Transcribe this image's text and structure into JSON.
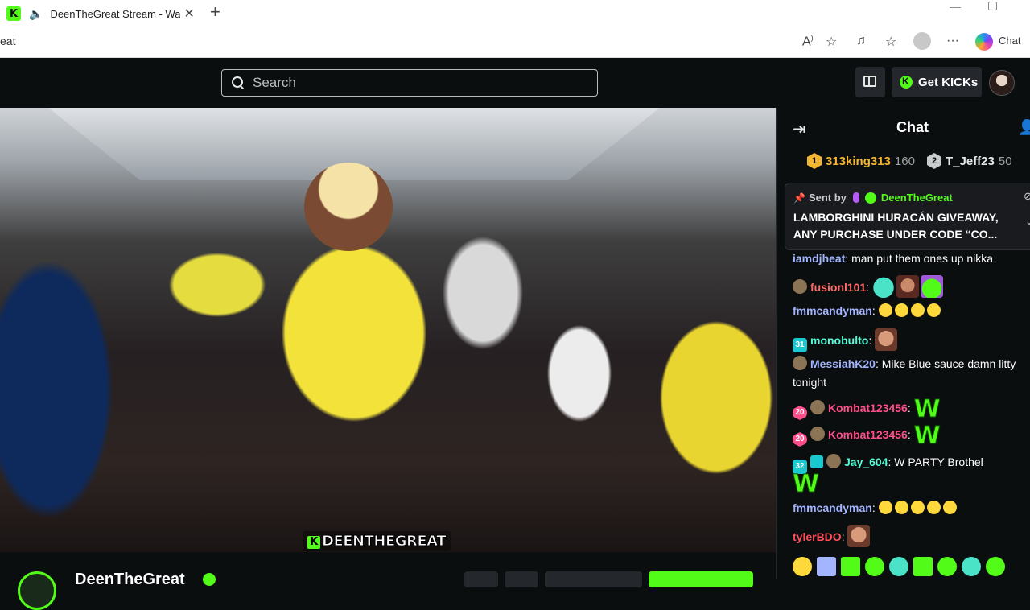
{
  "browser": {
    "tab_title": "DeenTheGreat Stream - Watch",
    "tab_favicon_letter": "K",
    "address_fragment": "eat",
    "chat_button": "Chat"
  },
  "header": {
    "search_placeholder": "Search",
    "get_kicks": "Get KICKs"
  },
  "video": {
    "watermark": "DEENTHEGREAT",
    "watermark_k": "K"
  },
  "channel": {
    "name": "DeenTheGreat"
  },
  "chat": {
    "title": "Chat",
    "leaderboard": [
      {
        "rank": "1",
        "name": "313king313",
        "count": "160",
        "color": "#f5b731"
      },
      {
        "rank": "2",
        "name": "T_Jeff23",
        "count": "50",
        "color": "#c9cccd"
      }
    ],
    "pinned": {
      "sent_by": "Sent by",
      "author": "DeenTheGreat",
      "text": "LAMBORGHINI HURACÁN GIVEAWAY, ANY PURCHASE UNDER CODE “CO..."
    },
    "messages": [
      {
        "user": "iamdjheat",
        "color": "#a3b5ff",
        "text": "man put them ones up nikka"
      },
      {
        "user": "fusionl101",
        "color": "#ff6b6b",
        "text": ""
      },
      {
        "user": "fmmcandyman",
        "color": "#a3b5ff",
        "text": ""
      },
      {
        "user": "monobulto",
        "color": "#53fcd6",
        "text": "",
        "badge": "31"
      },
      {
        "user": "MessiahK20",
        "color": "#a3b5ff",
        "text": "Mike Blue sauce damn litty tonight"
      },
      {
        "user": "Kombat123456",
        "color": "#ff4f8a",
        "text": "",
        "badge": "20"
      },
      {
        "user": "Kombat123456",
        "color": "#ff4f8a",
        "text": "",
        "badge": "20"
      },
      {
        "user": "Jay_604",
        "color": "#53fcd6",
        "text": "W PARTY Brothel",
        "badge": "32"
      },
      {
        "user": "fmmcandyman",
        "color": "#a3b5ff",
        "text": ""
      },
      {
        "user": "tylerBDO",
        "color": "#ff4f5a",
        "text": ""
      }
    ],
    "big_w": "W"
  }
}
